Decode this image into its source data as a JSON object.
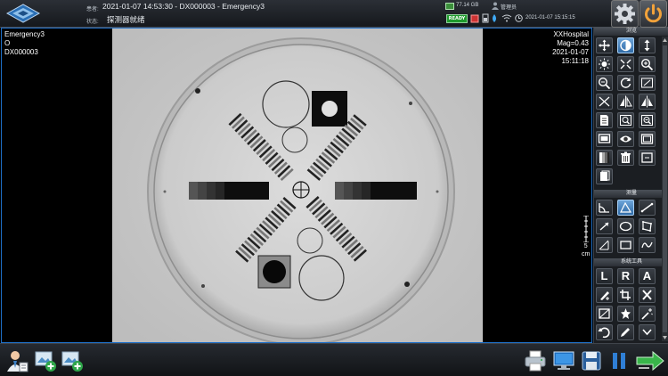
{
  "header": {
    "patient_label": "患者:",
    "patient_value": "2021-01-07 14:53:30 - DX000003 - Emergency3",
    "status_label": "状态:",
    "status_value": "探测器就绪",
    "disk_space": "77.14 GB",
    "user": "管理员",
    "ready_badge": "READY",
    "clock": "2021-01-07 15:15:15"
  },
  "overlay": {
    "left_lines": [
      "Emergency3",
      "O",
      "DX000003"
    ],
    "right_lines": [
      "XXHospital",
      "Mag=0.43",
      "2021-01-07",
      "15:11:18"
    ],
    "scale_value": "5",
    "scale_unit": "cm"
  },
  "tool_panel": {
    "sections": {
      "display": "浏览",
      "measure": "测量",
      "system": "系统工具"
    },
    "letters": [
      "L",
      "R",
      "A"
    ]
  },
  "colors": {
    "accent": "#1e6fc7",
    "ready": "#1f9a2d",
    "panel_bg": "#1b1e22"
  }
}
